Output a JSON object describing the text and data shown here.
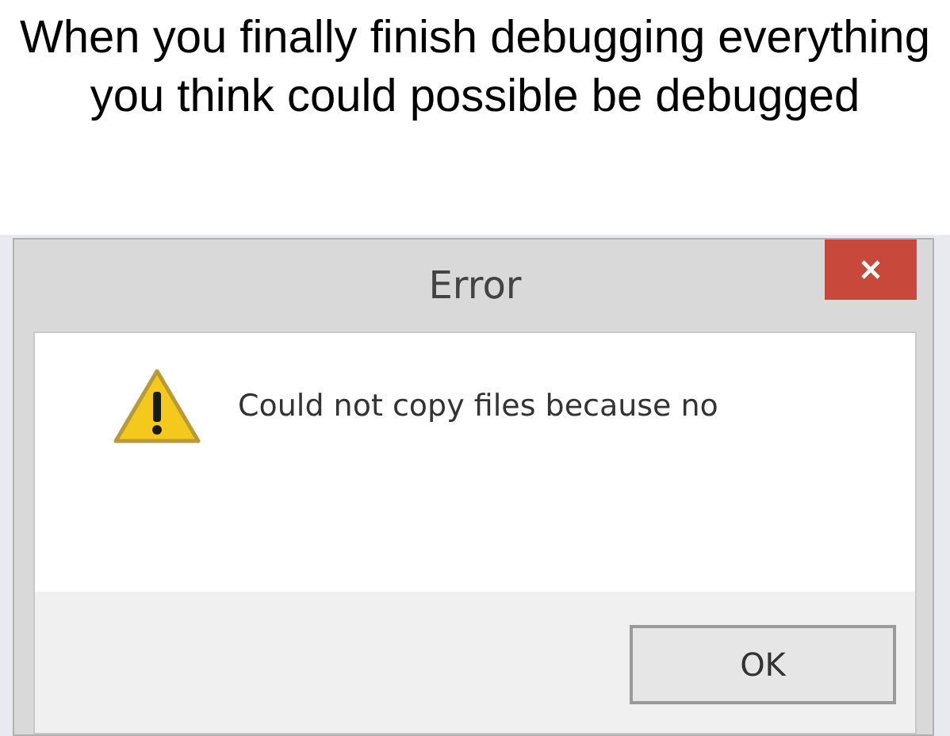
{
  "caption": "When you finally finish debugging everything you think could possible be debugged",
  "dialog": {
    "title": "Error",
    "message": "Could not copy files because no",
    "buttons": [
      "OK"
    ]
  }
}
